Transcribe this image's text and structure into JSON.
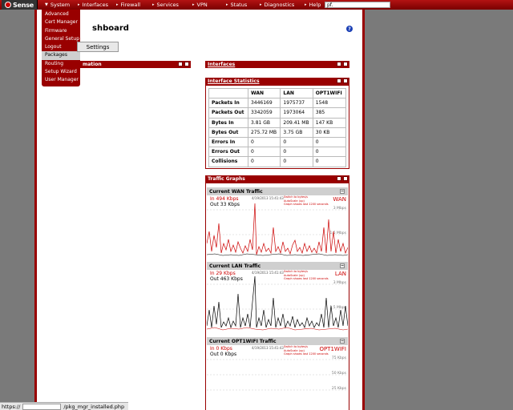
{
  "brand": {
    "logo_text": "Sense"
  },
  "topnav": {
    "items": [
      "System",
      "Interfaces",
      "Firewall",
      "Services",
      "VPN",
      "Status",
      "Diagnostics",
      "Help"
    ],
    "search_value": "pf."
  },
  "system_menu": {
    "items": [
      "Advanced",
      "Cert Manager",
      "Firmware",
      "General Setup",
      "Logout",
      "Packages",
      "Routing",
      "Setup Wizard",
      "User Manager"
    ],
    "active": "Packages"
  },
  "page": {
    "title": "shboard",
    "settings_button": "Settings",
    "help_glyph": "?"
  },
  "widgets": {
    "left_title": "mation",
    "interfaces_title": "Interfaces",
    "stats_title": "Interface Statistics",
    "graphs_title": "Traffic Graphs"
  },
  "stats": {
    "headers": [
      "",
      "WAN",
      "LAN",
      "OPT1WIFI"
    ],
    "rows": [
      [
        "Packets In",
        "3446169",
        "1975737",
        "1548"
      ],
      [
        "Packets Out",
        "3342059",
        "1973064",
        "385"
      ],
      [
        "Bytes In",
        "3.81 GB",
        "209.41 MB",
        "147 KB"
      ],
      [
        "Bytes Out",
        "275.72 MB",
        "3.75 GB",
        "30 KB"
      ],
      [
        "Errors In",
        "0",
        "0",
        "0"
      ],
      [
        "Errors Out",
        "0",
        "0",
        "0"
      ],
      [
        "Collisions",
        "0",
        "0",
        "0"
      ]
    ]
  },
  "graphs": [
    {
      "header": "Current WAN Traffic",
      "in": "In    494 Kbps",
      "out": "Out 33 Kbps",
      "name": "WAN",
      "tick1": "3 Mbps",
      "tick2": "1.5 Mbps"
    },
    {
      "header": "Current LAN Traffic",
      "in": "In    29 Kbps",
      "out": "Out 463 Kbps",
      "name": "LAN",
      "tick1": "3 Mbps",
      "tick2": "1.5 Mbps"
    },
    {
      "header": "Current OPT1WIFI Traffic",
      "in": "In    0 Kbps",
      "out": "Out 0 Kbps",
      "name": "OPT1WIFI",
      "tick1": "75 Kbps",
      "tick2": "50 Kbps",
      "tick3": "25 Kbps"
    }
  ],
  "graph_meta": {
    "date": "4/19/2013 15:41:43",
    "note1": "Switch to bytes/s",
    "note2": "AutoScale (up)",
    "note3": "Graph shows last 1200 seconds"
  },
  "status_bar": {
    "left": "https://",
    "right": "/pkg_mgr_installed.php"
  },
  "colors": {
    "accent": "#990000",
    "in_series": "#cc0000",
    "out_series": "#000000"
  }
}
